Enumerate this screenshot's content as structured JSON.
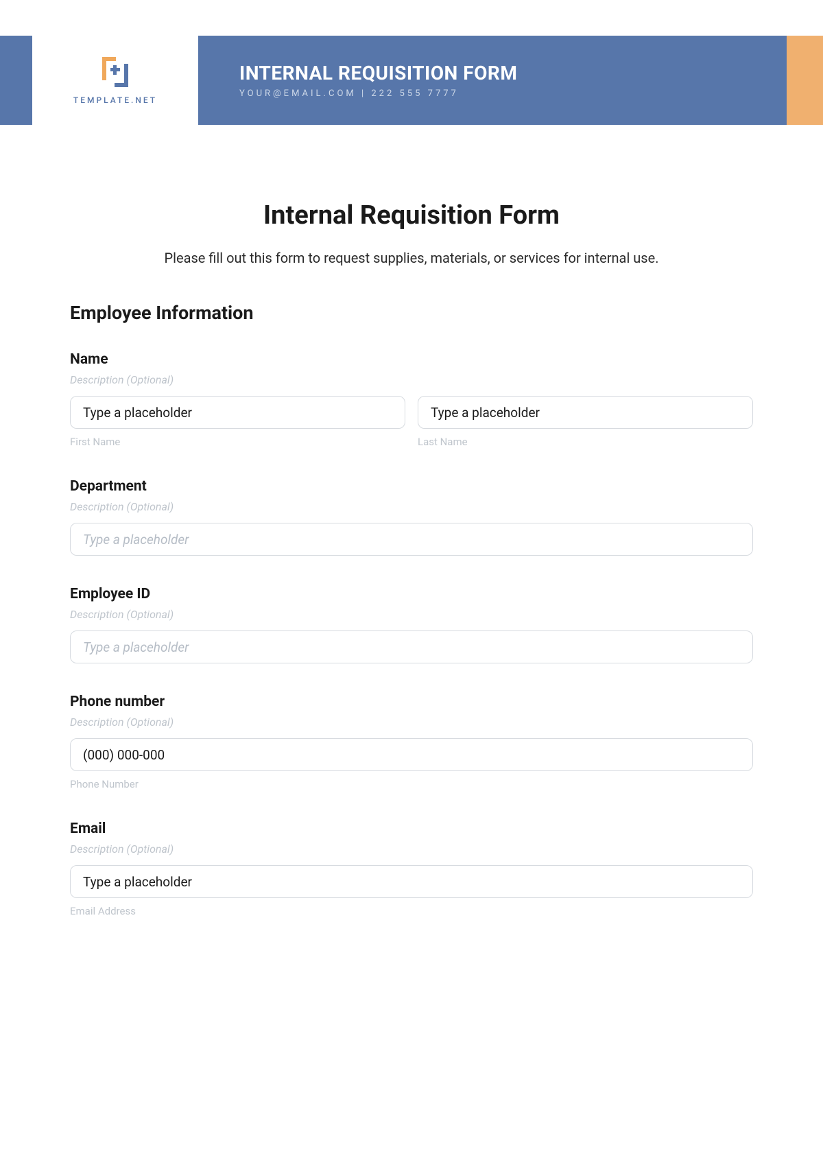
{
  "banner": {
    "logo_text": "TEMPLATE.NET",
    "title": "INTERNAL REQUISITION FORM",
    "contact": "YOUR@EMAIL.COM | 222 555 7777"
  },
  "form": {
    "title": "Internal Requisition Form",
    "intro": "Please fill out this form to request supplies, materials, or services for internal use.",
    "section_employee": "Employee Information",
    "fields": {
      "name": {
        "label": "Name",
        "desc": "Description (Optional)",
        "first_value": "Type a placeholder",
        "first_sub": "First Name",
        "last_value": "Type a placeholder",
        "last_sub": "Last Name"
      },
      "department": {
        "label": "Department",
        "desc": "Description (Optional)",
        "placeholder": "Type a placeholder"
      },
      "employee_id": {
        "label": "Employee ID",
        "desc": "Description (Optional)",
        "placeholder": "Type a placeholder"
      },
      "phone": {
        "label": "Phone number",
        "desc": "Description (Optional)",
        "value": "(000) 000-000",
        "sub": "Phone Number"
      },
      "email": {
        "label": "Email",
        "desc": "Description (Optional)",
        "value": "Type a placeholder",
        "sub": "Email Address"
      }
    }
  }
}
